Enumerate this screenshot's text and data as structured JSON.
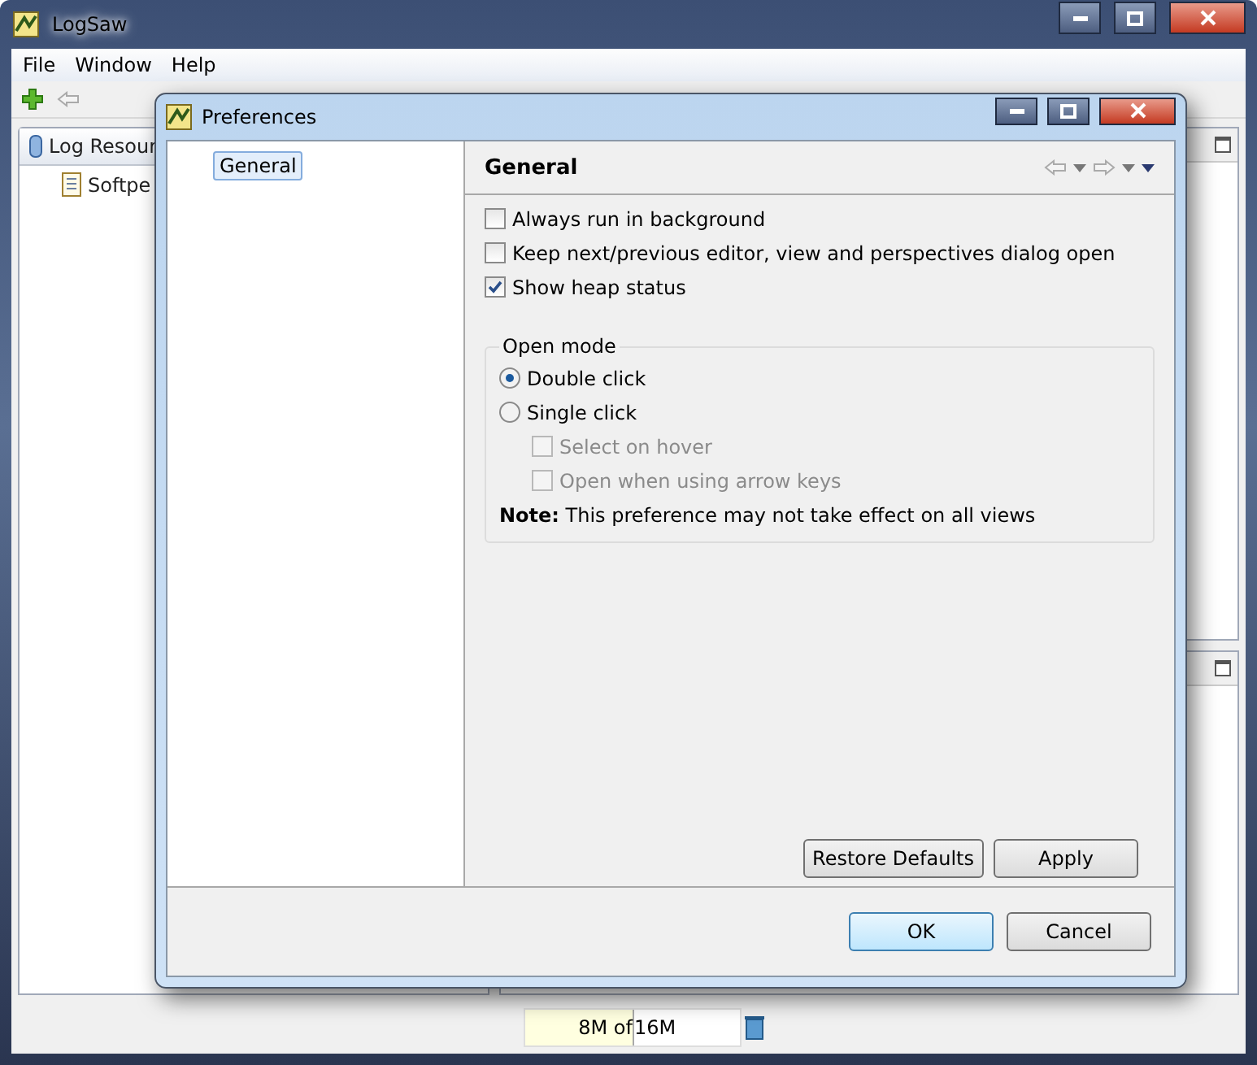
{
  "main_window": {
    "title": "LogSaw",
    "menu": [
      "File",
      "Window",
      "Help"
    ],
    "view_tab": "Log Resour",
    "tree_items": [
      "Softpe"
    ],
    "heap_status": {
      "used": "8M of",
      "total": "16M",
      "level": 0.5
    }
  },
  "dialog": {
    "title": "Preferences",
    "nav": [
      {
        "label": "General",
        "selected": true
      }
    ],
    "page_title": "General",
    "options": [
      {
        "label": "Always run in background",
        "checked": false
      },
      {
        "label": "Keep next/previous editor, view and perspectives dialog open",
        "checked": false
      },
      {
        "label": "Show heap status",
        "checked": true
      }
    ],
    "group": {
      "title": "Open mode",
      "radios": [
        {
          "label": "Double click",
          "selected": true
        },
        {
          "label": "Single click",
          "selected": false
        }
      ],
      "sub_options": [
        {
          "label": "Select on hover",
          "checked": false,
          "disabled": true
        },
        {
          "label": "Open when using arrow keys",
          "checked": false,
          "disabled": true
        }
      ],
      "note": "**Note:** This preference may not take effect on all views"
    },
    "page_buttons": [
      "Restore Defaults",
      "Apply"
    ],
    "buttons": [
      {
        "label": "OK",
        "default": true
      },
      {
        "label": "Cancel",
        "default": false
      }
    ]
  }
}
